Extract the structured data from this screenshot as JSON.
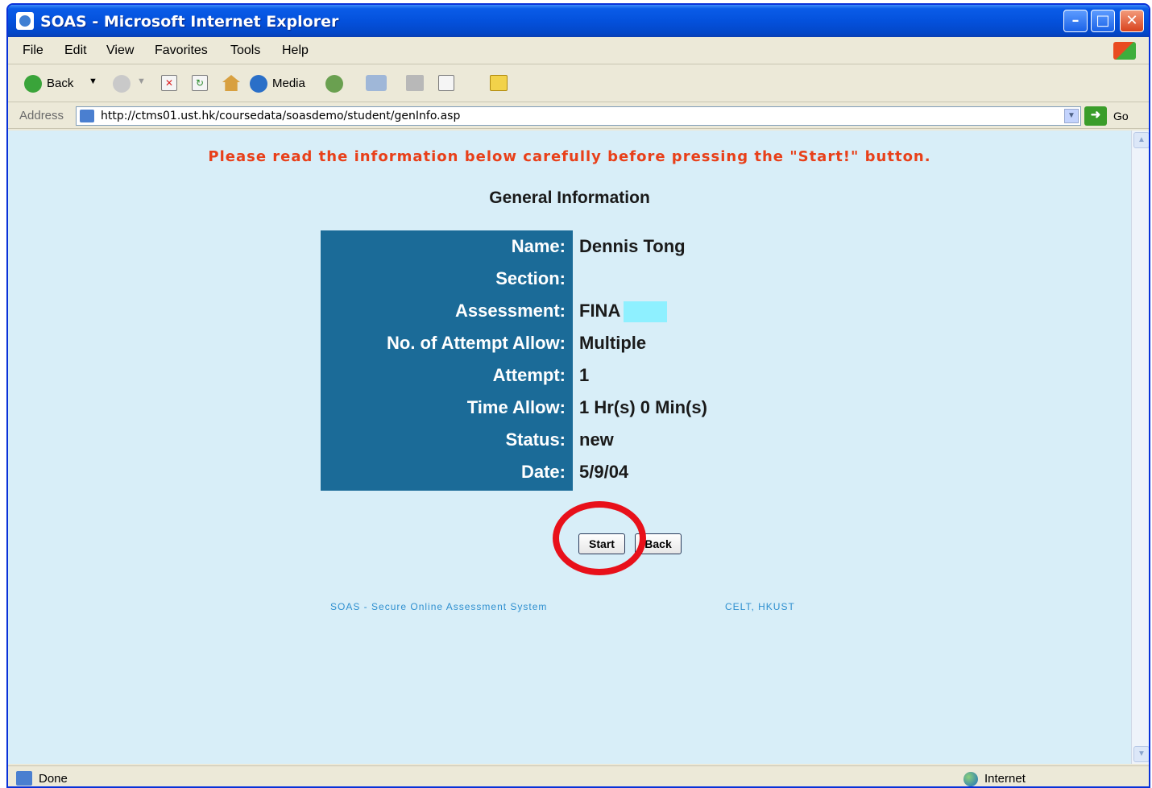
{
  "window": {
    "title": "SOAS - Microsoft Internet Explorer",
    "controls": {
      "minimize": "–",
      "maximize": "□",
      "close": "✕"
    }
  },
  "menubar": {
    "items": [
      "File",
      "Edit",
      "View",
      "Favorites",
      "Tools",
      "Help"
    ]
  },
  "toolbar": {
    "back_label": "Back",
    "media_label": "Media"
  },
  "address": {
    "label": "Address",
    "url": "http://ctms01.ust.hk/coursedata/soasdemo/student/genInfo.asp",
    "go_label": "Go"
  },
  "page": {
    "notice": "Please read the information below carefully before pressing the \"Start!\" button.",
    "section_title": "General Information",
    "info": [
      {
        "label": "Name:",
        "value": "Dennis Tong"
      },
      {
        "label": "Section:",
        "value": ""
      },
      {
        "label": "Assessment:",
        "value": "FINA"
      },
      {
        "label": "No. of Attempt Allow:",
        "value": "Multiple"
      },
      {
        "label": "Attempt:",
        "value": "1"
      },
      {
        "label": "Time Allow:",
        "value": "1 Hr(s) 0 Min(s)"
      },
      {
        "label": "Status:",
        "value": "new"
      },
      {
        "label": "Date:",
        "value": "5/9/04"
      }
    ],
    "start_button": "Start",
    "back_button": "Back",
    "footer_left": "SOAS - Secure Online Assessment System",
    "footer_right": "CELT, HKUST"
  },
  "statusbar": {
    "status": "Done",
    "zone": "Internet"
  },
  "colors": {
    "notice": "#e8401a",
    "label_column": "#1b6b98",
    "content_bg": "#d8eef8",
    "highlight_ring": "#e8101a"
  }
}
